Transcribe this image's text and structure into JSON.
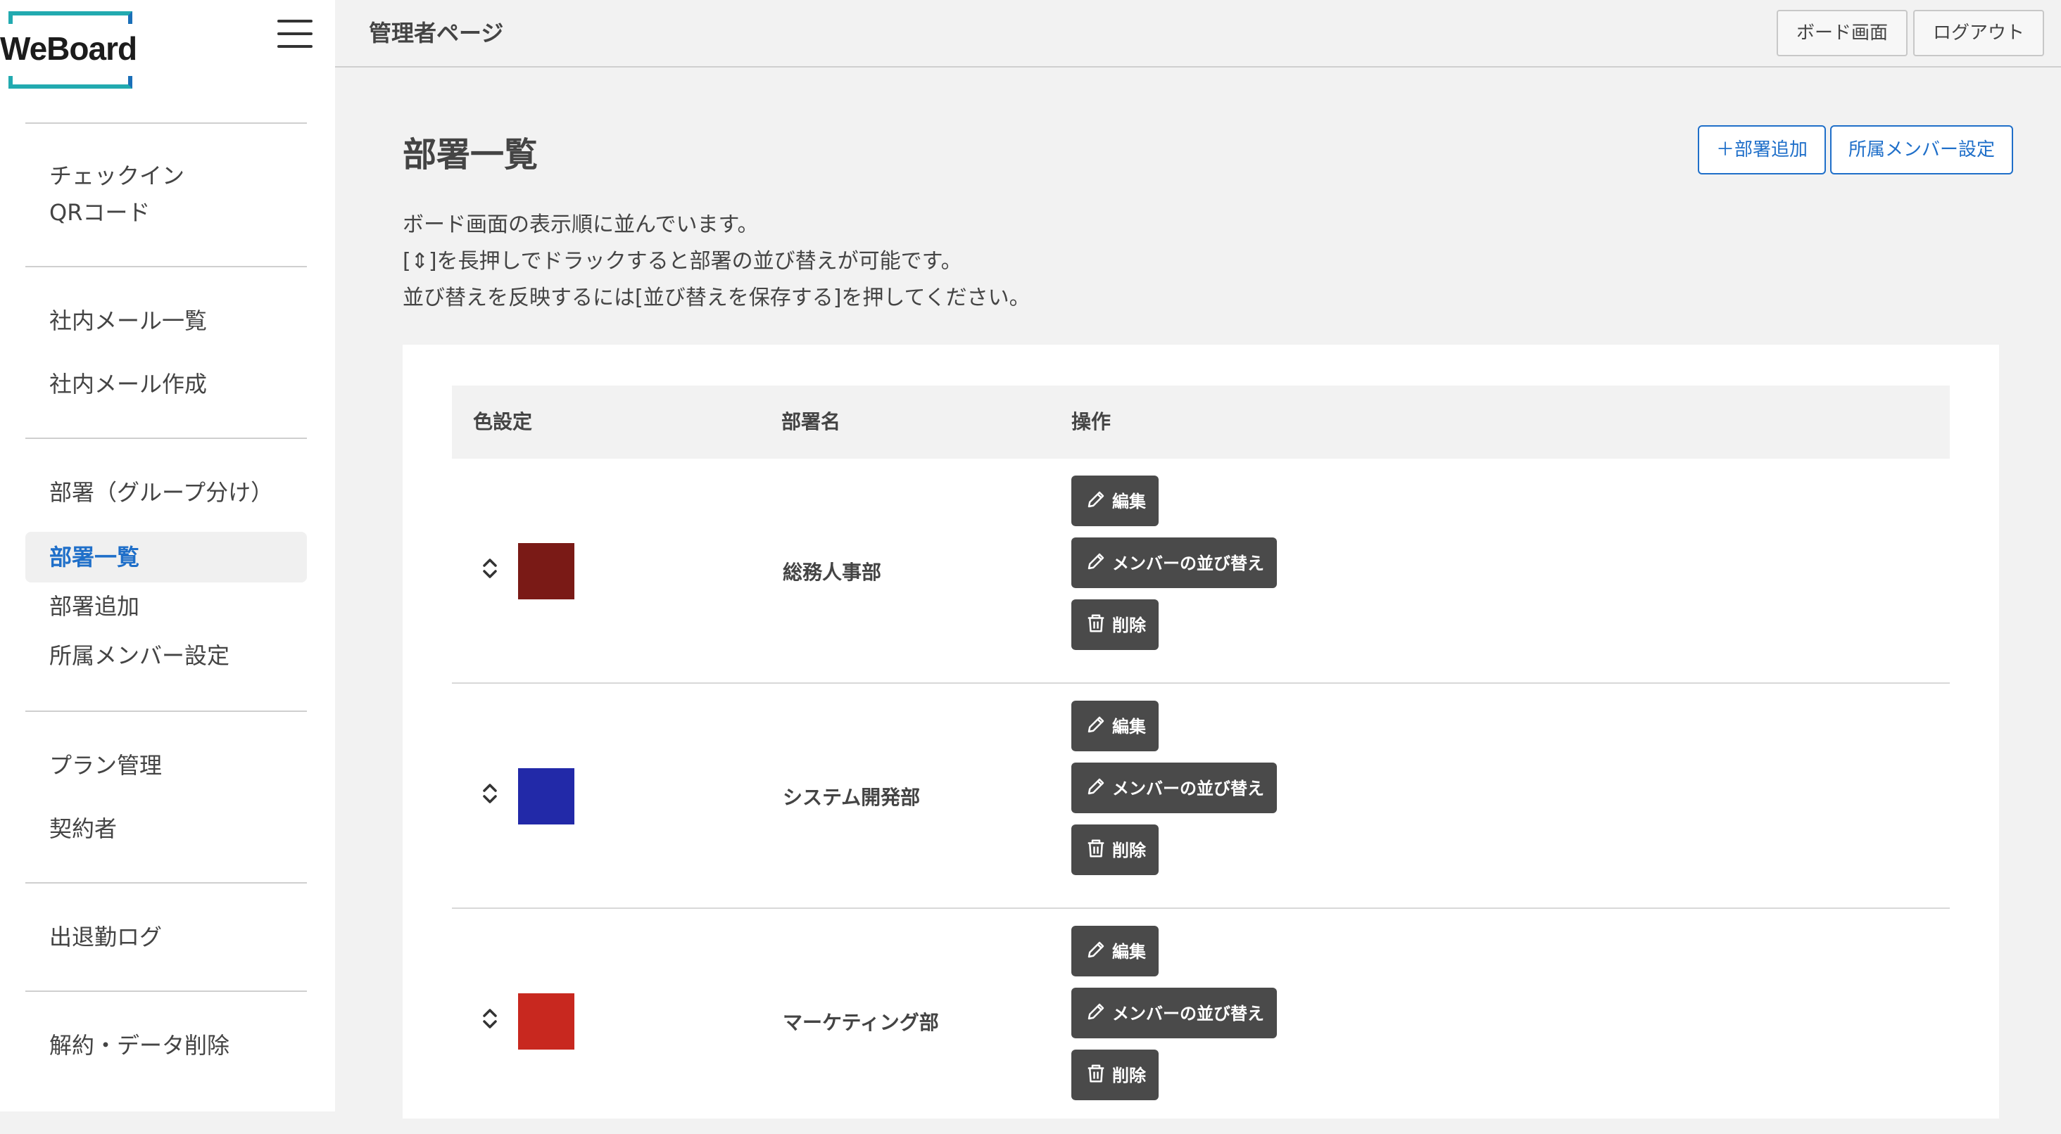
{
  "logo": {
    "text": "WeBoard"
  },
  "header": {
    "title": "管理者ページ",
    "board_button": "ボード画面",
    "logout_button": "ログアウト"
  },
  "sidebar": {
    "checkin_line1": "チェックイン",
    "checkin_line2": "QRコード",
    "mail_list": "社内メール一覧",
    "mail_create": "社内メール作成",
    "dept_group": "部署（グループ分け）",
    "dept_list": "部署一覧",
    "dept_add": "部署追加",
    "member_setting": "所属メンバー設定",
    "plan": "プラン管理",
    "contractor": "契約者",
    "attendance_log": "出退勤ログ",
    "cancel": "解約・データ削除"
  },
  "main": {
    "title": "部署一覧",
    "add_button": "＋部署追加",
    "member_button": "所属メンバー設定",
    "desc_line1": "ボード画面の表示順に並んでいます。",
    "desc_line2": "[⇕]を長押しでドラックすると部署の並び替えが可能です。",
    "desc_line3": "並び替えを反映するには[並び替えを保存する]を押してください。"
  },
  "table": {
    "col_color": "色設定",
    "col_name": "部署名",
    "col_ops": "操作",
    "edit_label": "編集",
    "reorder_label": "メンバーの並び替え",
    "delete_label": "削除",
    "rows": [
      {
        "name": "総務人事部",
        "color": "#7a1a16"
      },
      {
        "name": "システム開発部",
        "color": "#2229a8"
      },
      {
        "name": "マーケティング部",
        "color": "#c8281f"
      }
    ]
  },
  "icons": {
    "pencil": "pencil-icon",
    "trash": "trash-icon",
    "drag": "drag-handle-icon",
    "menu": "hamburger-icon"
  }
}
